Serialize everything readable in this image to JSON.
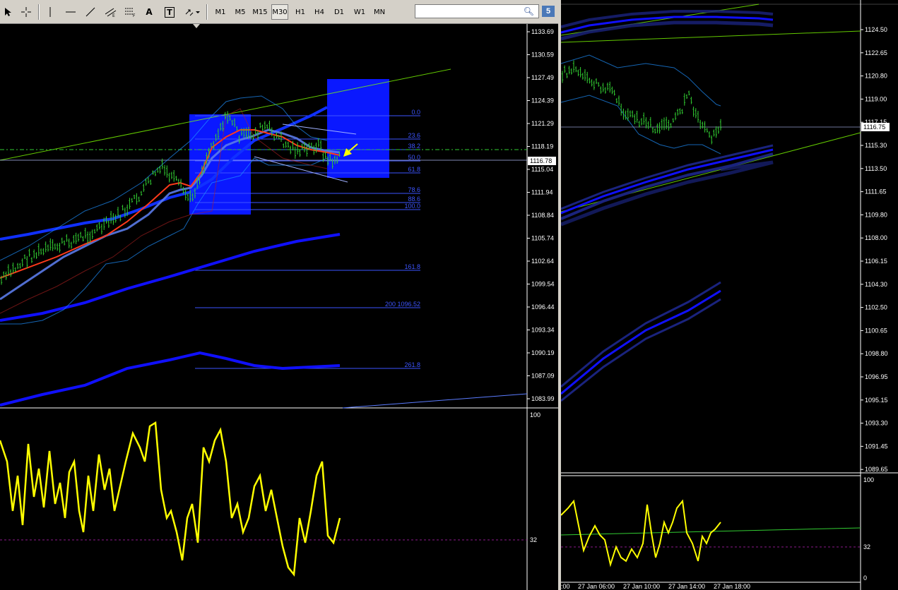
{
  "toolbar": {
    "timeframes": [
      "M1",
      "M5",
      "M15",
      "M30",
      "H1",
      "H4",
      "D1",
      "W1",
      "MN"
    ],
    "active_timeframe": "M30",
    "tool_letters": {
      "text": "A",
      "label": "T"
    },
    "badge": "5"
  },
  "left_chart": {
    "price_levels": [
      "1133.69",
      "1130.59",
      "1127.49",
      "1124.39",
      "1121.29",
      "1118.19",
      "1115.04",
      "1111.94",
      "1108.84",
      "1105.74",
      "1102.64",
      "1099.54",
      "1096.44",
      "1093.34",
      "1090.19",
      "1087.09",
      "1083.99"
    ],
    "current_price": "1116.78",
    "fib_levels": [
      "0.0",
      "23.6",
      "38.2",
      "50.0",
      "61.8",
      "78.6",
      "88.6",
      "100.0",
      "161.8",
      "200 1096.52",
      "261.8"
    ],
    "osc_levels": [
      "100",
      "32"
    ]
  },
  "right_chart": {
    "price_levels": [
      "1124.50",
      "1122.65",
      "1120.80",
      "1119.00",
      "1117.15",
      "1115.30",
      "1113.50",
      "1111.65",
      "1109.80",
      "1108.00",
      "1106.15",
      "1104.30",
      "1102.50",
      "1100.65",
      "1098.80",
      "1096.95",
      "1095.15",
      "1093.30",
      "1091.45",
      "1089.65"
    ],
    "current_price": "1116.75",
    "osc_levels": [
      "100",
      "32",
      "0"
    ],
    "time_labels": [
      ":00",
      "27 Jan 06:00",
      "27 Jan 10:00",
      "27 Jan 14:00",
      "27 Jan 18:00"
    ]
  },
  "colors": {
    "background": "#000000",
    "candles": "#32cd32",
    "oscillator": "#ffff00",
    "ma_blue": "#1010ff",
    "ma_red": "#ff3a1a",
    "fib": "#3d55ff",
    "trendline": "#7cfc00"
  }
}
